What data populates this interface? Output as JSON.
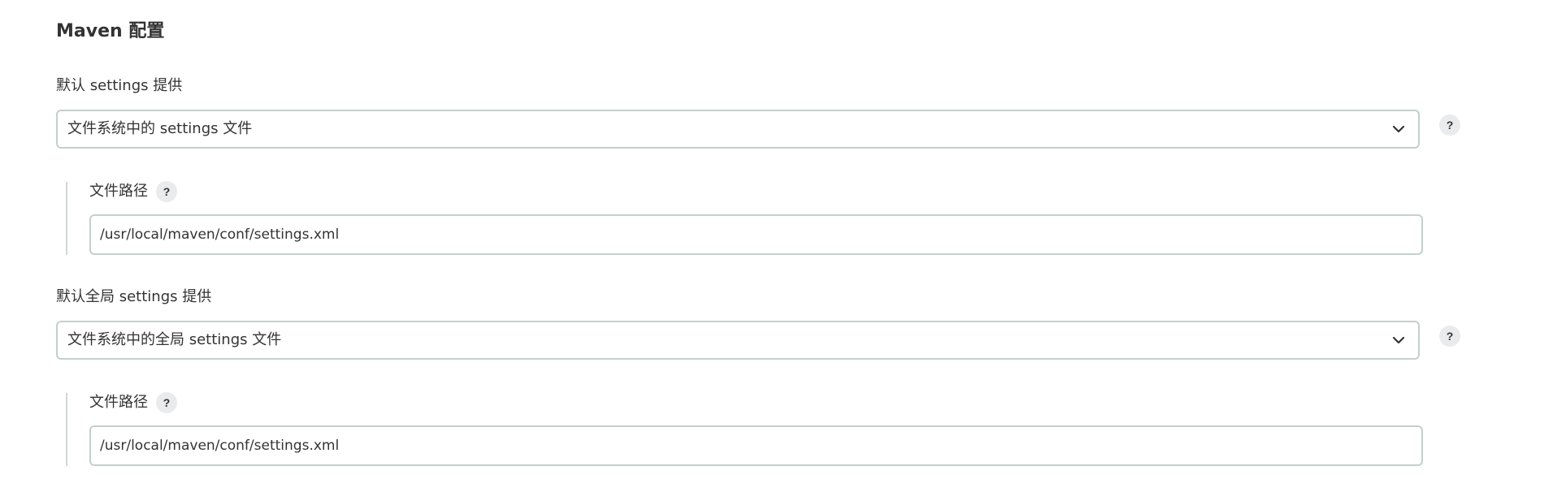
{
  "section": {
    "title": "Maven 配置"
  },
  "settings_provider": {
    "label": "默认 settings 提供",
    "selected": "文件系统中的 settings 文件",
    "help": "?",
    "path": {
      "label": "文件路径",
      "help": "?",
      "value": "/usr/local/maven/conf/settings.xml"
    }
  },
  "global_settings_provider": {
    "label": "默认全局 settings 提供",
    "selected": "文件系统中的全局 settings 文件",
    "help": "?",
    "path": {
      "label": "文件路径",
      "help": "?",
      "value": "/usr/local/maven/conf/settings.xml"
    }
  },
  "icons": {
    "dropdown": "chevron-down-icon",
    "help": "question-mark-icon"
  }
}
